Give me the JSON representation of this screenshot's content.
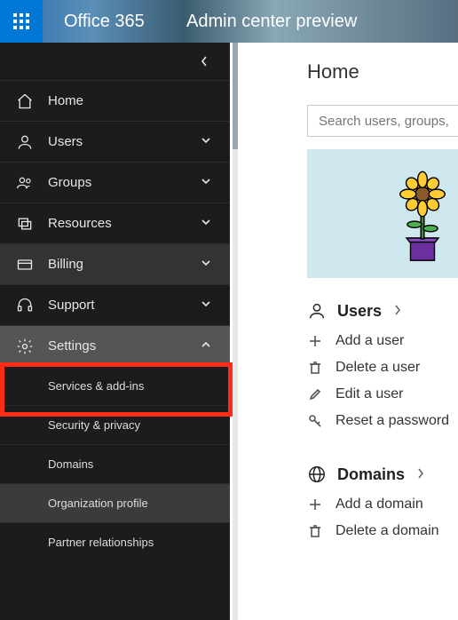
{
  "banner": {
    "product": "Office 365",
    "area": "Admin center preview"
  },
  "nav": {
    "home": "Home",
    "users": "Users",
    "groups": "Groups",
    "resources": "Resources",
    "billing": "Billing",
    "support": "Support",
    "settings": "Settings",
    "settings_children": {
      "services": "Services & add-ins",
      "security": "Security & privacy",
      "domains": "Domains",
      "orgprofile": "Organization profile",
      "partners": "Partner relationships"
    }
  },
  "main": {
    "title": "Home",
    "search_placeholder": "Search users, groups,",
    "sections": {
      "users": {
        "title": "Users",
        "links": {
          "add": "Add a user",
          "delete": "Delete a user",
          "edit": "Edit a user",
          "reset": "Reset a password"
        }
      },
      "domains": {
        "title": "Domains",
        "links": {
          "add": "Add a domain",
          "delete": "Delete a domain"
        }
      }
    }
  }
}
